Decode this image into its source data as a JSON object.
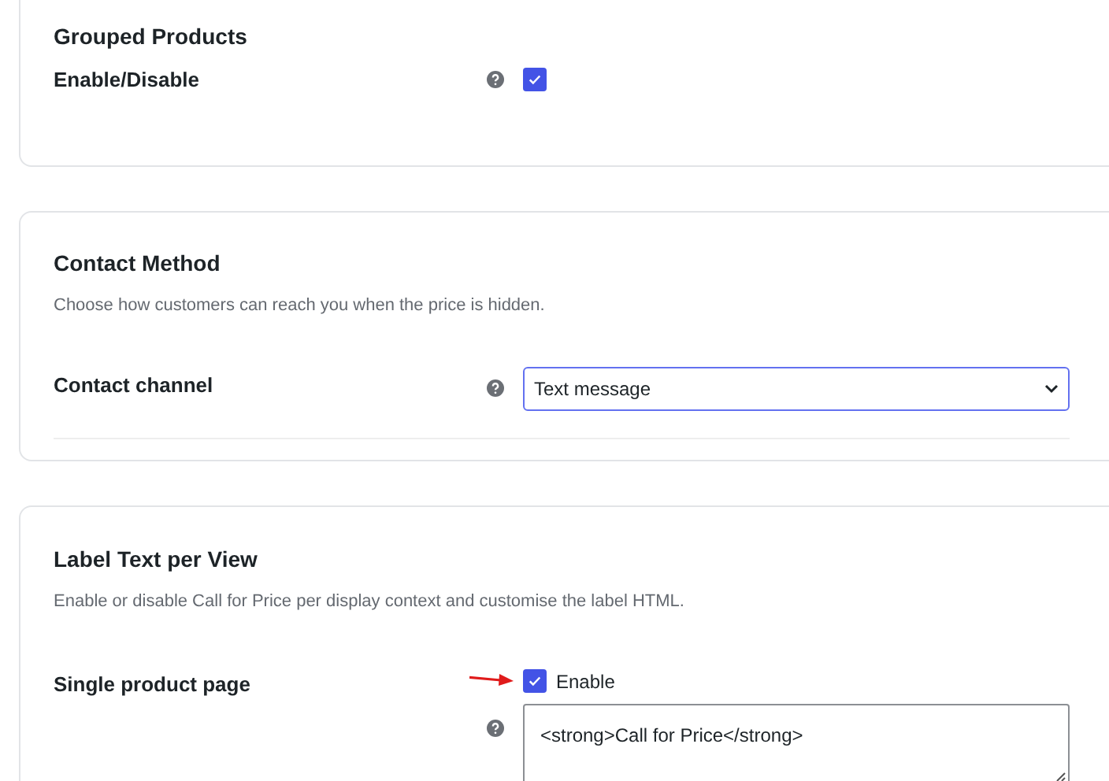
{
  "sections": [
    {
      "title": "Grouped Products",
      "rows": [
        {
          "kind": "checkbox",
          "label": "Enable/Disable",
          "checked": true
        }
      ]
    },
    {
      "title": "Contact Method",
      "description": "Choose how customers can reach you when the price is hidden.",
      "rows": [
        {
          "kind": "select",
          "label": "Contact channel",
          "value": "Text message"
        }
      ]
    },
    {
      "title": "Label Text per View",
      "description": "Enable or disable Call for Price per display context and customise the label HTML.",
      "rows": [
        {
          "kind": "checkbox-textarea",
          "label": "Single product page",
          "checked": true,
          "checkbox_label": "Enable",
          "value": "<strong>Call for Price</strong>",
          "pointer": true
        }
      ]
    }
  ]
}
